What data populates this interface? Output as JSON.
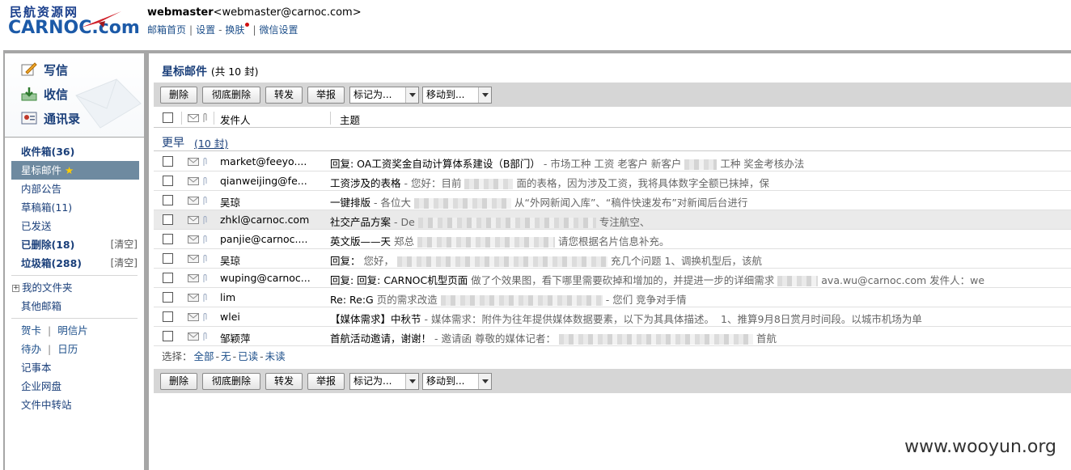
{
  "header": {
    "logo_cn": "民航资源网",
    "logo_en": "CARNOC.com",
    "user_name": "webmaster",
    "user_email": "<webmaster@carnoc.com>",
    "links": [
      "邮箱首页",
      "设置",
      "换肤",
      "微信设置"
    ],
    "link_separators": [
      "|",
      "-",
      "|"
    ]
  },
  "sidebar": {
    "compose": "写信",
    "receive": "收信",
    "contacts": "通讯录",
    "folders": [
      {
        "label": "收件箱(36)",
        "bold": true
      },
      {
        "label": "星标邮件",
        "active": true
      },
      {
        "label": "内部公告"
      },
      {
        "label": "草稿箱(11)"
      },
      {
        "label": "已发送"
      },
      {
        "label": "已删除(18)",
        "bold": true,
        "action": "[清空]"
      },
      {
        "label": "垃圾箱(288)",
        "bold": true,
        "action": "[清空]"
      }
    ],
    "my_folders": "我的文件夹",
    "other_mailbox": "其他邮箱",
    "tools_row1": [
      "贺卡",
      "明信片"
    ],
    "tools_row2": [
      "待办",
      "日历"
    ],
    "notepad": "记事本",
    "netdisk": "企业网盘",
    "transfer": "文件中转站",
    "tool_sep": "|"
  },
  "main": {
    "title": "星标邮件",
    "count": "(共 10 封)",
    "toolbar": {
      "delete": "删除",
      "purge": "彻底删除",
      "forward": "转发",
      "report": "举报",
      "mark_as": "标记为...",
      "move_to": "移动到..."
    },
    "columns": {
      "from": "发件人",
      "subject": "主题"
    },
    "group": {
      "label": "更早",
      "count": "(10 封)"
    },
    "rows": [
      {
        "from": "market@feeyo....",
        "subject": "回复: OA工资奖金自动计算体系建设（B部门）",
        "preview": "- 市场工种 工资 老客户 新客户",
        "tail": "工种 奖金考核办法",
        "hl": false
      },
      {
        "from": "qianweijing@fe...",
        "subject": "工资涉及的表格",
        "preview": "- 您好：目前",
        "tail": "面的表格，因为涉及工资，我将具体数字全额已抹掉，保",
        "hl": false
      },
      {
        "from": "吴琼",
        "subject": "一键排版",
        "preview": "- 各位大",
        "tail": "从“外网新闻入库”、“稿件快速发布”对新闻后台进行",
        "hl": false
      },
      {
        "from": "zhkl@carnoc.com",
        "subject": "社交产品方案",
        "preview": "- De",
        "tail": "专注航空、",
        "hl": true
      },
      {
        "from": "panjie@carnoc....",
        "subject": "英文版——天",
        "preview": "郑总",
        "tail": "请您根据名片信息补充。",
        "hl": false
      },
      {
        "from": "吴琼",
        "subject": "回复：",
        "preview": "您好，",
        "tail": "充几个问题 1、调换机型后，该航",
        "hl": false
      },
      {
        "from": "wuping@carnoc...",
        "subject": "回复: 回复: CARNOC机型页面",
        "preview": "做了个效果图，看下哪里需要砍掉和增加的，并提进一步的详细需求",
        "tail": "ava.wu@carnoc.com  发件人：we",
        "hl": false
      },
      {
        "from": "lim",
        "subject": "Re: Re:G",
        "preview": "页的需求改造",
        "tail": "- 您们 竞争对手情",
        "hl": false
      },
      {
        "from": "wlei",
        "subject": "【媒体需求】中秋节",
        "preview": "- 媒体需求：附件为往年提供媒体数据要素，以下为其具体描述。",
        "tail": "1、推算9月8日赏月时间段。以城市机场为单",
        "hl": false
      },
      {
        "from": "邹颖萍",
        "subject": "首航活动邀请，谢谢！",
        "preview": "- 邀请函 尊敬的媒体记者：",
        "tail": "首航",
        "hl": false
      }
    ],
    "select": {
      "label": "选择：",
      "options": [
        "全部",
        "无",
        "已读",
        "未读"
      ],
      "sep": "-"
    }
  },
  "watermark": "www.wooyun.org",
  "colors": {
    "brand_blue": "#1c5aa8",
    "link": "#1d4f8a",
    "active_folder": "#6e8aa0",
    "toolbar_bg": "#d6d6d6",
    "frame": "#a6a6a6"
  }
}
